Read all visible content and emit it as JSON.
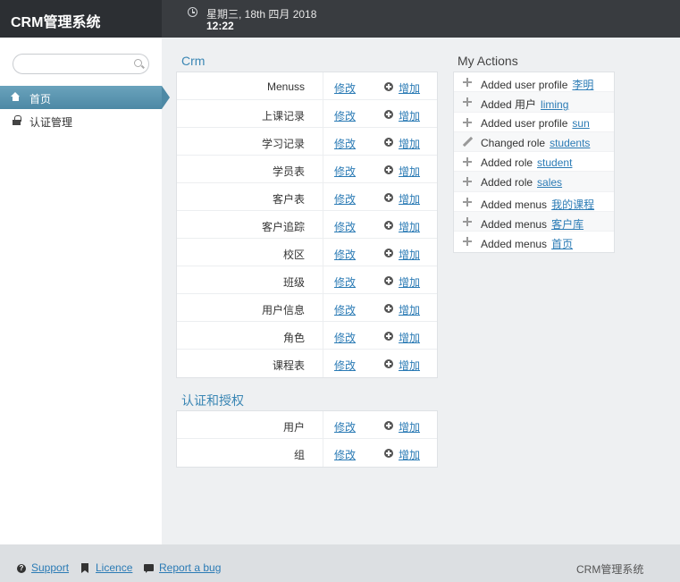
{
  "header": {
    "brand": "CRM管理系统",
    "date": "星期三, 18th 四月 2018",
    "time": "12:22"
  },
  "sidebar": {
    "search_placeholder": "",
    "items": [
      {
        "label": "首页",
        "icon": "home-icon",
        "active": true
      },
      {
        "label": "认证管理",
        "icon": "lock-icon",
        "active": false
      }
    ]
  },
  "modules": [
    {
      "title": "Crm",
      "rows": [
        {
          "name": "Menuss",
          "edit": "修改",
          "add": "增加"
        },
        {
          "name": "上课记录",
          "edit": "修改",
          "add": "增加"
        },
        {
          "name": "学习记录",
          "edit": "修改",
          "add": "增加"
        },
        {
          "name": "学员表",
          "edit": "修改",
          "add": "增加"
        },
        {
          "name": "客户表",
          "edit": "修改",
          "add": "增加"
        },
        {
          "name": "客户追踪",
          "edit": "修改",
          "add": "增加"
        },
        {
          "name": "校区",
          "edit": "修改",
          "add": "增加"
        },
        {
          "name": "班级",
          "edit": "修改",
          "add": "增加"
        },
        {
          "name": "用户信息",
          "edit": "修改",
          "add": "增加"
        },
        {
          "name": "角色",
          "edit": "修改",
          "add": "增加"
        },
        {
          "name": "课程表",
          "edit": "修改",
          "add": "增加"
        }
      ]
    },
    {
      "title": "认证和授权",
      "rows": [
        {
          "name": "用户",
          "edit": "修改",
          "add": "增加"
        },
        {
          "name": "组",
          "edit": "修改",
          "add": "增加"
        }
      ]
    }
  ],
  "actions": {
    "title": "My Actions",
    "items": [
      {
        "icon": "plus-icon",
        "text": "Added user profile",
        "link": "李明"
      },
      {
        "icon": "plus-icon",
        "text": "Added 用户",
        "link": "liming"
      },
      {
        "icon": "plus-icon",
        "text": "Added user profile",
        "link": "sun"
      },
      {
        "icon": "pencil-icon",
        "text": "Changed role",
        "link": "students"
      },
      {
        "icon": "plus-icon",
        "text": "Added role",
        "link": "student"
      },
      {
        "icon": "plus-icon",
        "text": "Added role",
        "link": "sales"
      },
      {
        "icon": "plus-icon",
        "text": "Added menus",
        "link": "我的课程"
      },
      {
        "icon": "plus-icon",
        "text": "Added menus",
        "link": "客户库"
      },
      {
        "icon": "plus-icon",
        "text": "Added menus",
        "link": "首页"
      }
    ]
  },
  "footer": {
    "support": "Support",
    "licence": "Licence",
    "report": "Report a bug",
    "brand": "CRM管理系统"
  },
  "colors": {
    "accent": "#3a86b4",
    "link": "#2b7bb5",
    "topbar": "#393c40",
    "nav_active": "#5a95b0"
  }
}
